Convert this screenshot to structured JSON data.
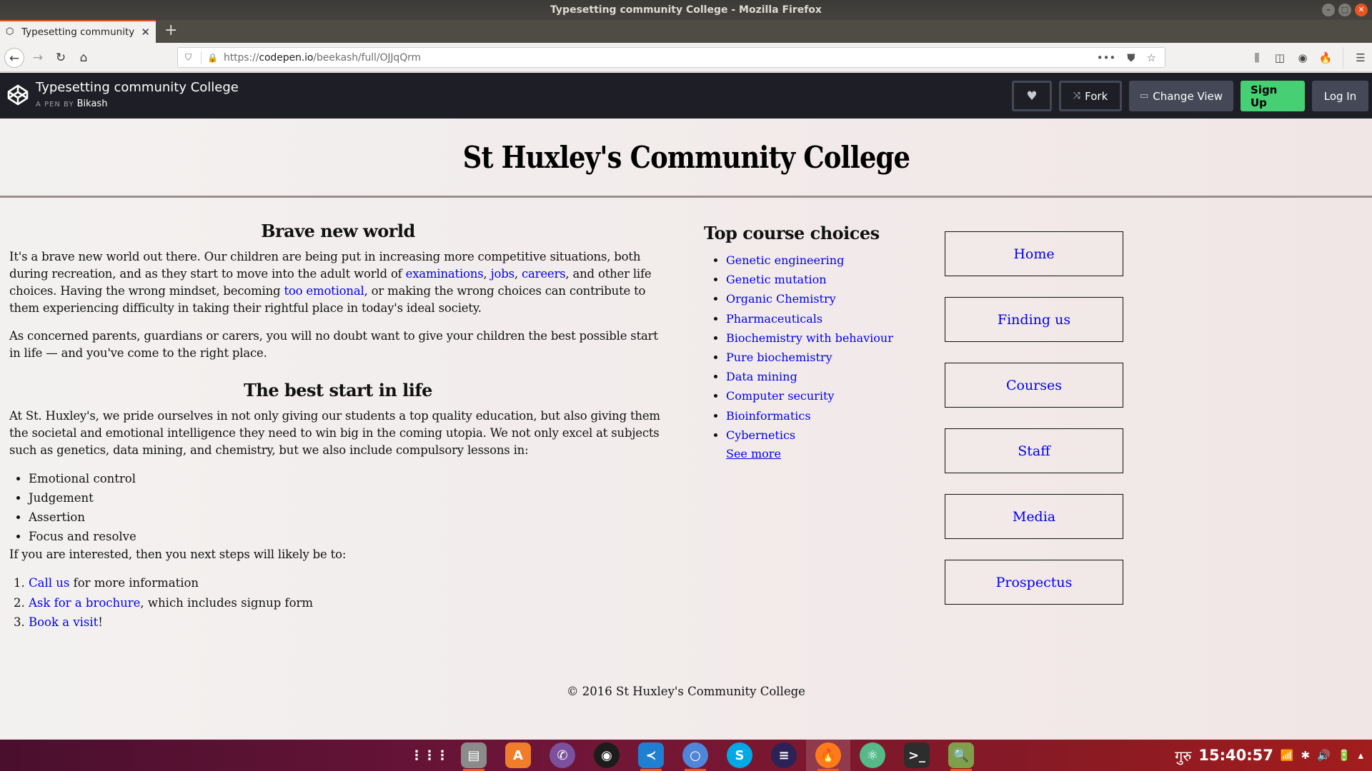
{
  "window": {
    "title": "Typesetting community College - Mozilla Firefox",
    "controls": [
      "minimize",
      "maximize",
      "close"
    ]
  },
  "browser": {
    "tab": {
      "title": "Typesetting community College",
      "favicon": "codepen-icon"
    },
    "url": {
      "scheme": "https://",
      "host": "codepen.io",
      "path": "/beekash/full/OJJqQrm"
    },
    "toolbar_icons": [
      "library-icon",
      "sidebar-icon",
      "account-icon",
      "extension-icon",
      "menu-icon"
    ]
  },
  "codepen": {
    "pen_title": "Typesetting community College",
    "by_label": "A PEN BY",
    "author": "Bikash",
    "buttons": {
      "fork": "Fork",
      "change_view": "Change View",
      "sign_up": "Sign Up",
      "log_in": "Log In"
    },
    "colors": {
      "header_bg": "#1e1f26",
      "signup_green": "#47cf73",
      "button_grey": "#444857"
    }
  },
  "page": {
    "title": "St Huxley's Community College",
    "sections": [
      {
        "heading": "Brave new world",
        "p1": {
          "t1": "It's a brave new world out there. Our children are being put in increasing more competitive situations, both during recreation, and as they start to move into the adult world of ",
          "link1": "examinations",
          "t2": ", ",
          "link2": "jobs",
          "t3": ", ",
          "link3": "careers",
          "t4": ", and other life choices. Having the wrong mindset, becoming ",
          "link4": "too emotional",
          "t5": ", or making the wrong choices can contribute to them experiencing difficulty in taking their rightful place in today's ideal society."
        },
        "p2": "As concerned parents, guardians or carers, you will no doubt want to give your children the best possible start in life — and you've come to the right place."
      },
      {
        "heading": "The best start in life",
        "p1": "At St. Huxley's, we pride ourselves in not only giving our students a top quality education, but also giving them the societal and emotional intelligence they need to win big in the coming utopia. We not only excel at subjects such as genetics, data mining, and chemistry, but we also include compulsory lessons in:",
        "lessons": [
          "Emotional control",
          "Judgement",
          "Assertion",
          "Focus and resolve"
        ],
        "next_intro": "If you are interested, then you next steps will likely be to:",
        "steps": [
          {
            "link": "Call us",
            "rest": " for more information"
          },
          {
            "link": "Ask for a brochure",
            "rest": ", which includes signup form"
          },
          {
            "link": "Book a visit",
            "rest": "!"
          }
        ]
      }
    ],
    "courses": {
      "heading": "Top course choices",
      "items": [
        "Genetic engineering",
        "Genetic mutation",
        "Organic Chemistry",
        "Pharmaceuticals",
        "Biochemistry with behaviour",
        "Pure biochemistry",
        "Data mining",
        "Computer security",
        "Bioinformatics",
        "Cybernetics"
      ],
      "see_more": "See more"
    },
    "nav": [
      "Home",
      "Finding us",
      "Courses",
      "Staff",
      "Media",
      "Prospectus"
    ],
    "footer": "© 2016 St Huxley's Community College",
    "colors": {
      "link": "#0000ee",
      "header_rule": "#9b8e8e",
      "background": "#f1e8e8"
    }
  },
  "taskbar": {
    "apps": [
      {
        "name": "show-applications",
        "glyph": "⋮⋮⋮",
        "running": false,
        "active": false
      },
      {
        "name": "files",
        "glyph": "▤",
        "running": true,
        "active": false
      },
      {
        "name": "software-center",
        "glyph": "A",
        "running": false,
        "active": false
      },
      {
        "name": "viber",
        "glyph": "✆",
        "running": false,
        "active": false
      },
      {
        "name": "obs-studio",
        "glyph": "◉",
        "running": false,
        "active": false
      },
      {
        "name": "vscode",
        "glyph": "≺",
        "running": true,
        "active": false
      },
      {
        "name": "chromium",
        "glyph": "○",
        "running": true,
        "active": false
      },
      {
        "name": "skype",
        "glyph": "S",
        "running": false,
        "active": false
      },
      {
        "name": "eclipse",
        "glyph": "≡",
        "running": false,
        "active": false
      },
      {
        "name": "firefox",
        "glyph": "🔥",
        "running": true,
        "active": true
      },
      {
        "name": "atom",
        "glyph": "⚛",
        "running": false,
        "active": false
      },
      {
        "name": "terminal",
        "glyph": ">_",
        "running": false,
        "active": false
      },
      {
        "name": "image-viewer",
        "glyph": "🔍",
        "running": true,
        "active": false
      }
    ],
    "day": "गुरु",
    "time": "15:40:57"
  }
}
